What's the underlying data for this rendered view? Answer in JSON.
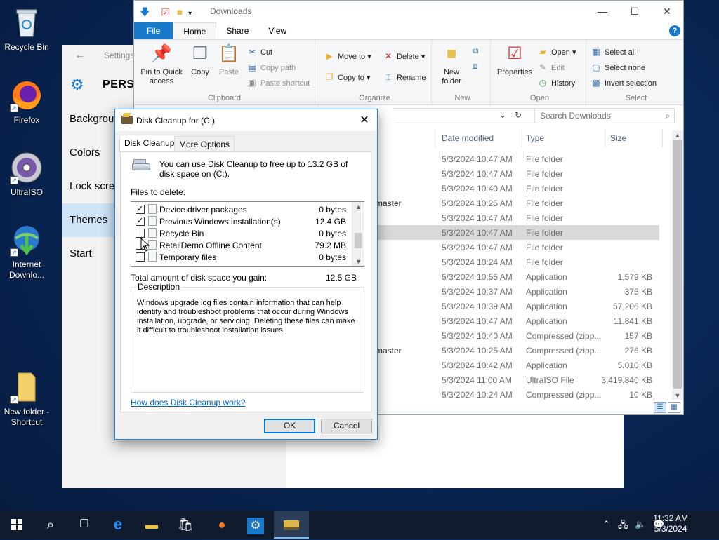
{
  "desktop": {
    "icons": [
      {
        "label": "Recycle Bin"
      },
      {
        "label": "Firefox"
      },
      {
        "label": "UltraISO"
      },
      {
        "label": "Internet Downlo..."
      },
      {
        "label": "New folder - Shortcut"
      }
    ]
  },
  "settings": {
    "title": "Settings",
    "heading": "PERSO",
    "nav": [
      "Background",
      "Colors",
      "Lock screen",
      "Themes",
      "Start"
    ],
    "selected": "Themes"
  },
  "explorer": {
    "title": "Downloads",
    "tabs": {
      "file": "File",
      "home": "Home",
      "share": "Share",
      "view": "View"
    },
    "ribbon": {
      "clipboard": {
        "pin": "Pin to Quick access",
        "copy": "Copy",
        "paste": "Paste",
        "cut": "Cut",
        "copy_path": "Copy path",
        "paste_shortcut": "Paste shortcut",
        "label": "Clipboard"
      },
      "organize": {
        "move_to": "Move to",
        "copy_to": "Copy to",
        "delete": "Delete",
        "rename": "Rename",
        "label": "Organize"
      },
      "new": {
        "new_folder": "New folder",
        "label": "New"
      },
      "open": {
        "properties": "Properties",
        "open": "Open",
        "edit": "Edit",
        "history": "History",
        "label": "Open"
      },
      "select": {
        "select_all": "Select all",
        "select_none": "Select none",
        "invert": "Invert selection",
        "label": "Select"
      }
    },
    "search_placeholder": "Search Downloads",
    "columns": {
      "date": "Date modified",
      "type": "Type",
      "size": "Size"
    },
    "rows": [
      {
        "name": "",
        "date": "5/3/2024 10:47 AM",
        "type": "File folder",
        "size": ""
      },
      {
        "name": "",
        "date": "5/3/2024 10:47 AM",
        "type": "File folder",
        "size": ""
      },
      {
        "name": "n",
        "date": "5/3/2024 10:40 AM",
        "type": "File folder",
        "size": ""
      },
      {
        "name": "-master",
        "date": "5/3/2024 10:25 AM",
        "type": "File folder",
        "size": ""
      },
      {
        "name": "",
        "date": "5/3/2024 10:47 AM",
        "type": "File folder",
        "size": ""
      },
      {
        "name": "",
        "date": "5/3/2024 10:47 AM",
        "type": "File folder",
        "size": ""
      },
      {
        "name": "",
        "date": "5/3/2024 10:47 AM",
        "type": "File folder",
        "size": ""
      },
      {
        "name": "",
        "date": "5/3/2024 10:24 AM",
        "type": "File folder",
        "size": ""
      },
      {
        "name": "",
        "date": "5/3/2024 10:55 AM",
        "type": "Application",
        "size": "1,579 KB"
      },
      {
        "name": "",
        "date": "5/3/2024 10:37 AM",
        "type": "Application",
        "size": "375 KB"
      },
      {
        "name": "",
        "date": "5/3/2024 10:39 AM",
        "type": "Application",
        "size": "57,206 KB"
      },
      {
        "name": "",
        "date": "5/3/2024 10:47 AM",
        "type": "Application",
        "size": "11,841 KB"
      },
      {
        "name": "n",
        "date": "5/3/2024 10:40 AM",
        "type": "Compressed (zipp...",
        "size": "157 KB"
      },
      {
        "name": "-master",
        "date": "5/3/2024 10:25 AM",
        "type": "Compressed (zipp...",
        "size": "276 KB"
      },
      {
        "name": "",
        "date": "5/3/2024 10:42 AM",
        "type": "Application",
        "size": "5,010 KB"
      },
      {
        "name": "",
        "date": "5/3/2024 11:00 AM",
        "type": "UltraISO File",
        "size": "3,419,840 KB"
      },
      {
        "name": "",
        "date": "5/3/2024 10:24 AM",
        "type": "Compressed (zipp...",
        "size": "10 KB"
      }
    ]
  },
  "dialog": {
    "title": "Disk Cleanup for  (C:)",
    "tabs": [
      "Disk Cleanup",
      "More Options"
    ],
    "intro": "You can use Disk Cleanup to free up to 13.2 GB of disk space on  (C:).",
    "files_label": "Files to delete:",
    "items": [
      {
        "label": "Device driver packages",
        "size": "0 bytes",
        "checked": "✓"
      },
      {
        "label": "Previous Windows installation(s)",
        "size": "12.4 GB",
        "checked": "✓"
      },
      {
        "label": "Recycle Bin",
        "size": "0 bytes",
        "checked": ""
      },
      {
        "label": "RetailDemo Offline Content",
        "size": "79.2 MB",
        "checked": ""
      },
      {
        "label": "Temporary files",
        "size": "0 bytes",
        "checked": ""
      }
    ],
    "total_label": "Total amount of disk space you gain:",
    "total_value": "12.5 GB",
    "description_label": "Description",
    "description": "Windows upgrade log files contain information that can help identify and troubleshoot problems that occur during Windows installation, upgrade, or servicing.  Deleting these files can make it difficult to troubleshoot installation issues.",
    "help_link": "How does Disk Cleanup work?",
    "ok": "OK",
    "cancel": "Cancel"
  },
  "taskbar": {
    "time": "11:32 AM",
    "date": "5/3/2024"
  }
}
